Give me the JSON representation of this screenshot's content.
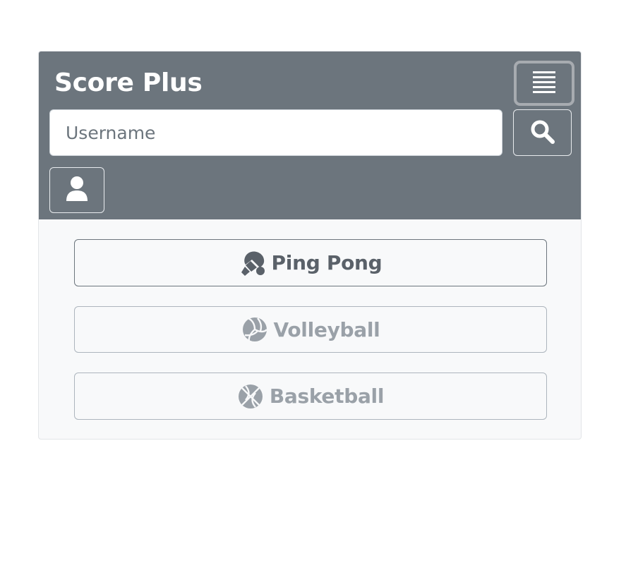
{
  "app": {
    "title": "Score Plus"
  },
  "header": {
    "menu_icon": "menu-icon",
    "search": {
      "placeholder": "Username",
      "value": "",
      "button_icon": "search-icon"
    },
    "user_button_icon": "user-icon"
  },
  "sports": [
    {
      "label": "Ping Pong",
      "icon": "ping-pong-icon",
      "active": true
    },
    {
      "label": "Volleyball",
      "icon": "volleyball-icon",
      "active": false
    },
    {
      "label": "Basketball",
      "icon": "basketball-icon",
      "active": false
    }
  ],
  "colors": {
    "header_bg": "#6c757d",
    "body_bg": "#f8f9fa",
    "active_text": "#5a6169",
    "inactive_text": "#9aa1a8"
  }
}
